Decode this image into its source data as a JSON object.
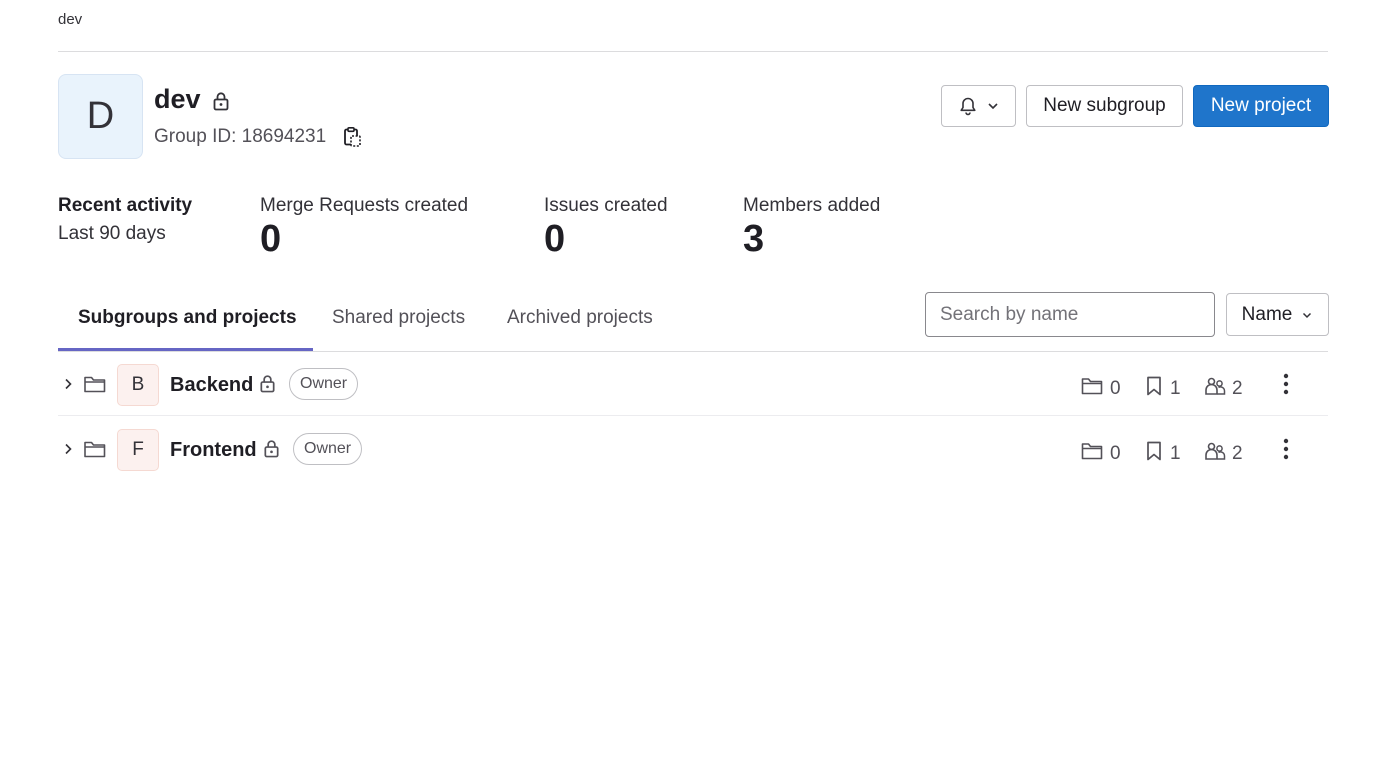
{
  "breadcrumb": "dev",
  "group": {
    "avatar_letter": "D",
    "name": "dev",
    "group_id_label": "Group ID: 18694231"
  },
  "header_actions": {
    "new_subgroup": "New subgroup",
    "new_project": "New project"
  },
  "activity": {
    "title": "Recent activity",
    "period": "Last 90 days",
    "stats": [
      {
        "label": "Merge Requests created",
        "value": "0"
      },
      {
        "label": "Issues created",
        "value": "0"
      },
      {
        "label": "Members added",
        "value": "3"
      }
    ]
  },
  "tabs": [
    {
      "label": "Subgroups and projects",
      "active": true
    },
    {
      "label": "Shared projects",
      "active": false
    },
    {
      "label": "Archived projects",
      "active": false
    }
  ],
  "search": {
    "placeholder": "Search by name",
    "value": ""
  },
  "sort": {
    "label": "Name"
  },
  "items": [
    {
      "avatar_letter": "B",
      "name": "Backend",
      "role": "Owner",
      "subgroups": "0",
      "projects": "1",
      "members": "2"
    },
    {
      "avatar_letter": "F",
      "name": "Frontend",
      "role": "Owner",
      "subgroups": "0",
      "projects": "1",
      "members": "2"
    }
  ],
  "colors": {
    "primary": "#1f75cb",
    "tab_underline": "#6666c4",
    "avatar_group_bg": "#e9f3fc",
    "avatar_subgroup_bg": "#fcf1ef"
  }
}
